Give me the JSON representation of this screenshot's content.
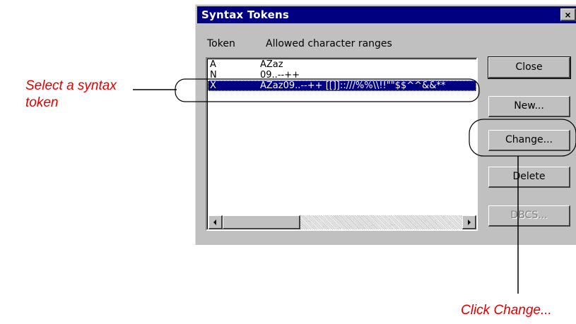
{
  "dialog": {
    "title": "Syntax Tokens",
    "close_glyph": "×",
    "columns": {
      "token": "Token",
      "ranges": "Allowed character ranges"
    },
    "rows": [
      {
        "token": "A",
        "ranges": "AZaz"
      },
      {
        "token": "N",
        "ranges": "09..--++"
      },
      {
        "token": "X",
        "ranges": "AZaz09..--++ [[]]::///%%\\\\!!\"\"$$^^&&**"
      }
    ],
    "selected_row": 2,
    "buttons": {
      "close": "Close",
      "new": "New...",
      "change": "Change...",
      "delete": "Delete",
      "dbcs": "DBCS..."
    }
  },
  "annotations": {
    "select_token": "Select a syntax token",
    "click_change": "Click Change..."
  },
  "colors": {
    "titlebar": "#000080",
    "face": "#c0c0c0",
    "selection": "#000080",
    "callout_text": "#e00000"
  }
}
